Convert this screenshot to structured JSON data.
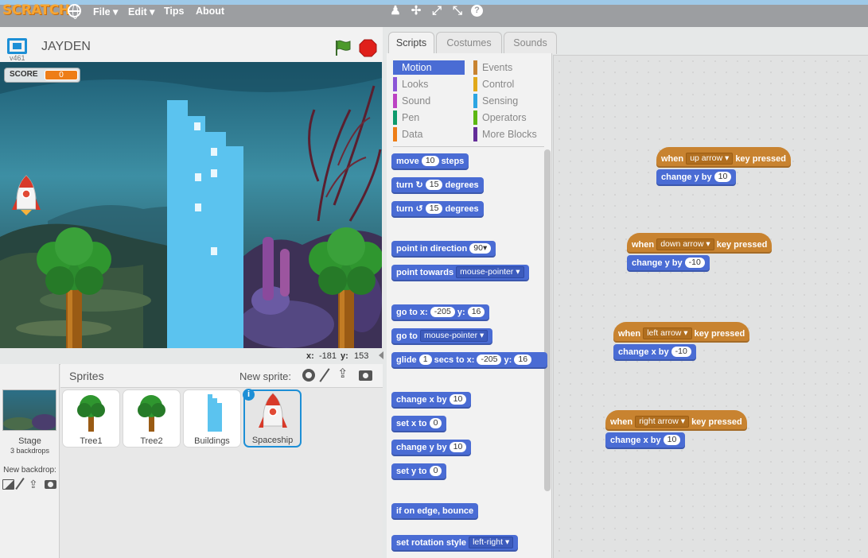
{
  "app": {
    "logo": "SCRATCH"
  },
  "menubar": {
    "items": [
      "File ▾",
      "Edit ▾",
      "Tips",
      "About"
    ],
    "toolbar_icons": [
      "duplicate-icon",
      "delete-icon",
      "grow-icon",
      "shrink-icon",
      "help-icon"
    ]
  },
  "stage": {
    "project_title": "JAYDEN",
    "version": "v461",
    "score_label": "SCORE",
    "score_value": "0",
    "coords_x_label": "x:",
    "coords_x": "-181",
    "coords_y_label": "y:",
    "coords_y": "153"
  },
  "sprites": {
    "header": "Sprites",
    "new_sprite_label": "New sprite:",
    "stage_label": "Stage",
    "stage_backdrops": "3 backdrops",
    "new_backdrop_label": "New backdrop:",
    "items": [
      "Tree1",
      "Tree2",
      "Buildings",
      "Spaceship"
    ]
  },
  "tabs": [
    "Scripts",
    "Costumes",
    "Sounds"
  ],
  "categories": {
    "left": [
      "Motion",
      "Looks",
      "Sound",
      "Pen",
      "Data"
    ],
    "right": [
      "Events",
      "Control",
      "Sensing",
      "Operators",
      "More Blocks"
    ],
    "colors": {
      "Motion": "#4a6cd4",
      "Looks": "#8a55d7",
      "Sound": "#bb42c3",
      "Pen": "#0e9a6c",
      "Data": "#ee7d16",
      "Events": "#c88330",
      "Control": "#e1a91a",
      "Sensing": "#2ca5e2",
      "Operators": "#5cb712",
      "More Blocks": "#632d99"
    }
  },
  "palette_blocks": {
    "move": {
      "a": "move",
      "n": "10",
      "b": "steps"
    },
    "turn_cw": {
      "a": "turn",
      "n": "15",
      "b": "degrees"
    },
    "turn_ccw": {
      "a": "turn",
      "n": "15",
      "b": "degrees"
    },
    "point_dir": {
      "a": "point in direction",
      "n": "90"
    },
    "point_towards": {
      "a": "point towards",
      "dd": "mouse-pointer"
    },
    "goto_xy": {
      "a": "go to x:",
      "x": "-205",
      "b": "y:",
      "y": "16"
    },
    "goto": {
      "a": "go to",
      "dd": "mouse-pointer"
    },
    "glide": {
      "a": "glide",
      "n": "1",
      "b": "secs to x:",
      "x": "-205",
      "c": "y:",
      "y": "16"
    },
    "change_x": {
      "a": "change x by",
      "n": "10"
    },
    "set_x": {
      "a": "set x to",
      "n": "0"
    },
    "change_y": {
      "a": "change y by",
      "n": "10"
    },
    "set_y": {
      "a": "set y to",
      "n": "0"
    },
    "bounce": {
      "a": "if on edge, bounce"
    },
    "rotation": {
      "a": "set rotation style",
      "dd": "left-right"
    }
  },
  "scripts": [
    {
      "when": "when",
      "key": "up arrow",
      "pressed": "key pressed",
      "action": "change y by",
      "value": "10"
    },
    {
      "when": "when",
      "key": "down arrow",
      "pressed": "key pressed",
      "action": "change y by",
      "value": "-10"
    },
    {
      "when": "when",
      "key": "left arrow",
      "pressed": "key pressed",
      "action": "change x by",
      "value": "-10"
    },
    {
      "when": "when",
      "key": "right arrow",
      "pressed": "key pressed",
      "action": "change x by",
      "value": "10"
    }
  ]
}
